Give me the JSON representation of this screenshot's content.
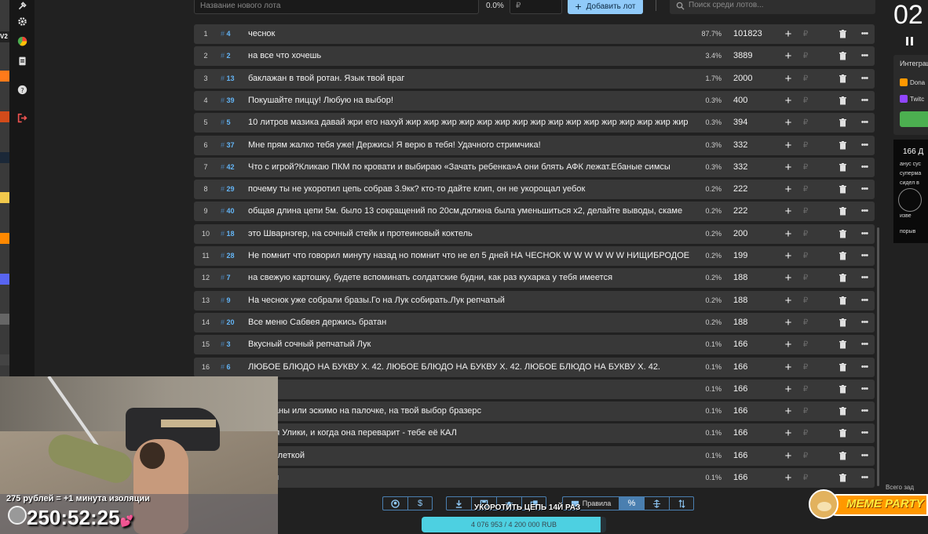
{
  "topbar": {
    "lot_name_placeholder": "Название нового лота",
    "percent_total": "0.0%",
    "price_placeholder": "₽",
    "add_button": "Добавить лот",
    "search_placeholder": "Поиск среди лотов..."
  },
  "lots": [
    {
      "index": "1",
      "id": "4",
      "name": "чеснок",
      "percent": "87.7%",
      "amount": "101823"
    },
    {
      "index": "2",
      "id": "2",
      "name": "на все что хочешь",
      "percent": "3.4%",
      "amount": "3889"
    },
    {
      "index": "3",
      "id": "13",
      "name": " баклажан в твой ротан. Язык твой враг",
      "percent": "1.7%",
      "amount": "2000"
    },
    {
      "index": "4",
      "id": "39",
      "name": "Покушайте пиццу! Любую на выбор!",
      "percent": "0.3%",
      "amount": "400"
    },
    {
      "index": "5",
      "id": "5",
      "name": "10 литров мазика давай жри его нахуй жир жир жир жир жир жир жир жир жир жир жир жир жир жир жир жир жир",
      "percent": "0.3%",
      "amount": "394"
    },
    {
      "index": "6",
      "id": "37",
      "name": "Мне прям жалко тебя уже! Держись! Я верю в тебя! Удачного стримчика!",
      "percent": "0.3%",
      "amount": "332"
    },
    {
      "index": "7",
      "id": "42",
      "name": "Что с игрой?Кликаю ПКМ по кровати и выбираю «Зачать ребенка»А они блять АФК лежат.Ебаные симсы",
      "percent": "0.3%",
      "amount": "332"
    },
    {
      "index": "8",
      "id": "29",
      "name": "почему ты не укоротил цепь собрав 3.9кк? кто-то дайте клип, он не укорощал уебок",
      "percent": "0.2%",
      "amount": "222"
    },
    {
      "index": "9",
      "id": "40",
      "name": "общая длина цепи 5м. было 13 сокращений по 20см,должна была уменьшиться х2, делайте выводы, скаме",
      "percent": "0.2%",
      "amount": "222"
    },
    {
      "index": "10",
      "id": "18",
      "name": "это Шварнэгер, на сочный стейк и протеиновый коктель",
      "percent": "0.2%",
      "amount": "200"
    },
    {
      "index": "11",
      "id": "28",
      "name": "Не помнит что говорил минуту назад но помнит что не ел 5 дней НА ЧЕСНОК  W W W W W W НИЩИБРОДОЕ",
      "percent": "0.2%",
      "amount": "199"
    },
    {
      "index": "12",
      "id": "7",
      "name": "на свежую картошку, будете вспоминать солдатские будни, как раз кухарка у тебя имеется",
      "percent": "0.2%",
      "amount": "188"
    },
    {
      "index": "13",
      "id": "9",
      "name": "На чеснок уже собрали бразы.Го на Лук собирать.Лук репчатый",
      "percent": "0.2%",
      "amount": "188"
    },
    {
      "index": "14",
      "id": "20",
      "name": "Все меню Сабвея держись братан",
      "percent": "0.2%",
      "amount": "188"
    },
    {
      "index": "15",
      "id": "3",
      "name": "Вкусный сочный репчатый Лук",
      "percent": "0.1%",
      "amount": "166"
    },
    {
      "index": "16",
      "id": "6",
      "name": "ЛЮБОЕ БЛЮДО НА БУКВУ Х. 42. ЛЮБОЕ БЛЮДО НА БУКВУ Х. 42. ЛЮБОЕ БЛЮДО НА БУКВУ Х. 42.",
      "percent": "0.1%",
      "amount": "166"
    },
    {
      "index": "",
      "id": "",
      "name": "",
      "percent": "0.1%",
      "amount": "166"
    },
    {
      "index": "",
      "id": "",
      "name": "а сметаны или эскимо на палочке, на твой выбор бразерс",
      "percent": "0.1%",
      "amount": "166"
    },
    {
      "index": "",
      "id": "",
      "name": "ера для Улики, и когда она переварит - тебе её КАЛ",
      "percent": "0.1%",
      "amount": "166"
    },
    {
      "index": "",
      "id": "",
      "name": "ку с котлеткой",
      "percent": "0.1%",
      "amount": "166"
    },
    {
      "index": "",
      "id": "",
      "name": "зый суп",
      "percent": "0.1%",
      "amount": "166"
    }
  ],
  "row_symbols": {
    "plus": "+",
    "currency": "₽",
    "more": "•••"
  },
  "right_panel": {
    "timer_partial": "02",
    "integrations_title": "Интеграц",
    "integration_1": "Dona",
    "integration_2": "Twitc",
    "promo_title": "166 Д",
    "promo_lines": [
      "анус сус",
      "супермa",
      "сидел в",
      "изве",
      "порыв"
    ],
    "total_label": "Всего зад"
  },
  "toolbar": {
    "rules_label": "Правила",
    "percent_label": "%"
  },
  "progress": {
    "text": "4 076 953 / 4 200 000 RUB",
    "fraction": 0.97
  },
  "overlay": {
    "chain_label": "УКОРОТИТЬ ЦЕПЬ 14Й РАЗ",
    "rate": "275 рублей = +1 минута изоляции",
    "timer": "250:52:25",
    "meme_label": "MEME PARTY"
  },
  "colors": {
    "accent": "#90caf9",
    "id": "#64b5f6",
    "row": "#383838",
    "progress": "#4dd0e1",
    "danger": "#ef5350"
  }
}
